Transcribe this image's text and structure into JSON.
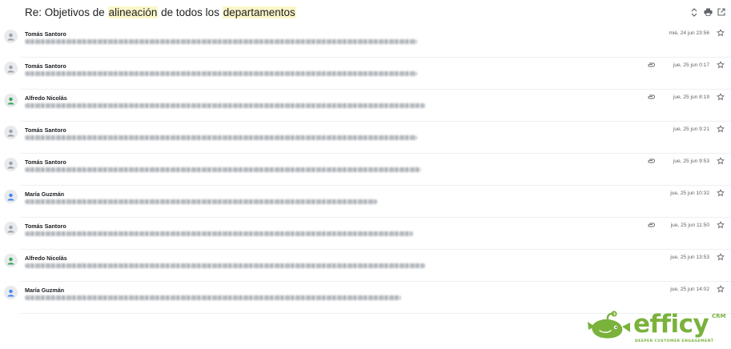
{
  "subject": {
    "prefix": "Re: Objetivos de",
    "highlight_1": "alineación",
    "middle": "de todos los",
    "highlight_2": "departamentos",
    "highlight_color": "#fbf6c9"
  },
  "header_icons": [
    "expand-collapse-icon",
    "print-icon",
    "open-in-new-window-icon"
  ],
  "messages": [
    {
      "sender": "Tomás Santoro",
      "date": "mié, 24 jun 23:56",
      "attachment": false,
      "avatar_color": "#9aa0a6"
    },
    {
      "sender": "Tomás Santoro",
      "date": "jue, 25 jun 0:17",
      "attachment": true,
      "avatar_color": "#9aa0a6"
    },
    {
      "sender": "Alfredo Nicolás",
      "date": "jue, 25 jun 8:19",
      "attachment": true,
      "avatar_color": "#34a853"
    },
    {
      "sender": "Tomás Santoro",
      "date": "jue, 25 jun 9:21",
      "attachment": false,
      "avatar_color": "#9aa0a6"
    },
    {
      "sender": "Tomás Santoro",
      "date": "jue, 25 jun 9:53",
      "attachment": true,
      "avatar_color": "#9aa0a6"
    },
    {
      "sender": "María Guzmán",
      "date": "jue, 25 jun 10:32",
      "attachment": false,
      "avatar_color": "#4285f4"
    },
    {
      "sender": "Tomás Santoro",
      "date": "jue, 25 jun 11:50",
      "attachment": true,
      "avatar_color": "#9aa0a6"
    },
    {
      "sender": "Alfredo Nicolás",
      "date": "jue, 25 jun 13:53",
      "attachment": false,
      "avatar_color": "#34a853"
    },
    {
      "sender": "María Guzmán",
      "date": "jue, 25 jun 14:02",
      "attachment": false,
      "avatar_color": "#4285f4"
    }
  ],
  "logo": {
    "wordmark": "efficy",
    "suffix": "CRM",
    "tagline": "DEEPER CUSTOMER ENGAGEMENT",
    "brand_color": "#7ab23c"
  }
}
